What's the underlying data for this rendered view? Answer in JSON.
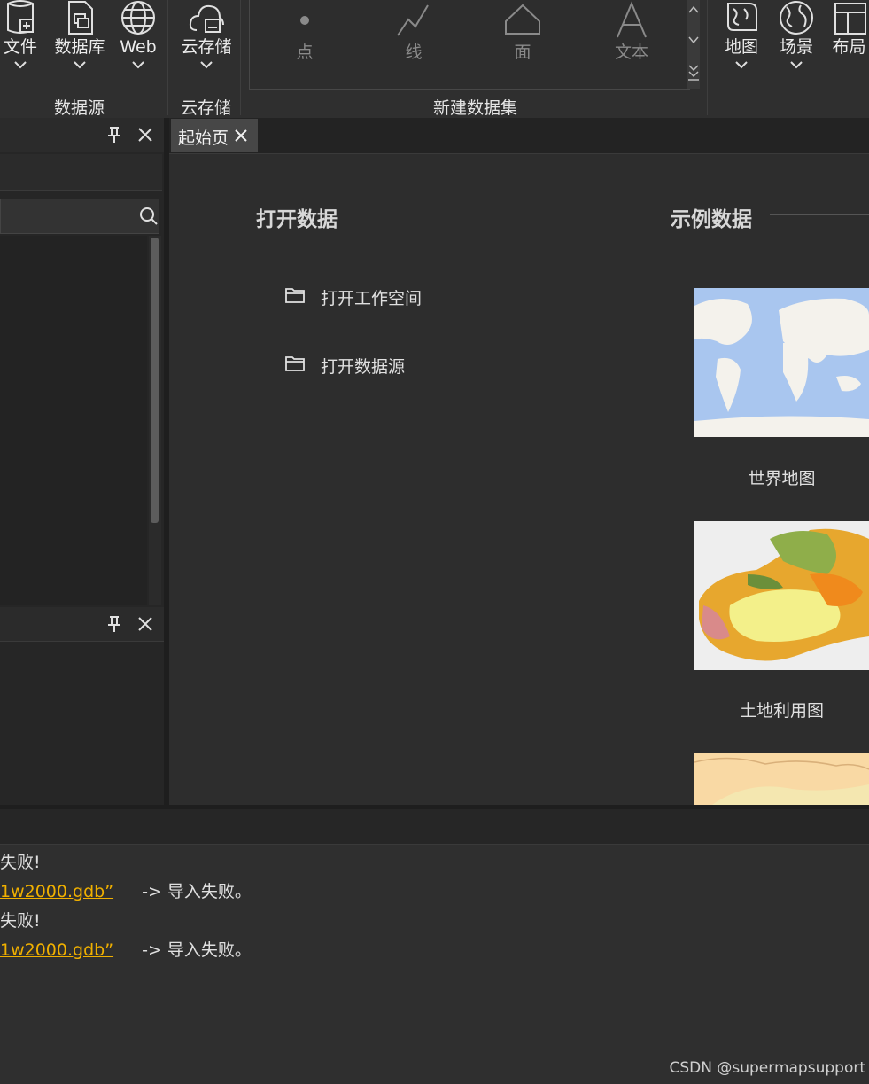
{
  "ribbon": {
    "datasource_group": {
      "label": "数据源",
      "buttons": [
        {
          "label": "文件",
          "icon": "file-datasource-icon"
        },
        {
          "label": "数据库",
          "icon": "database-icon"
        },
        {
          "label": "Web",
          "icon": "globe-icon"
        }
      ]
    },
    "cloud_group": {
      "label": "云存储",
      "buttons": [
        {
          "label": "云存储",
          "icon": "cloud-storage-icon"
        }
      ]
    },
    "dataset_group": {
      "label": "新建数据集",
      "items": [
        {
          "label": "点",
          "icon": "point-icon"
        },
        {
          "label": "线",
          "icon": "line-icon"
        },
        {
          "label": "面",
          "icon": "polygon-icon"
        },
        {
          "label": "文本",
          "icon": "text-icon"
        }
      ]
    },
    "window_buttons": [
      {
        "label": "地图",
        "icon": "map-icon"
      },
      {
        "label": "场景",
        "icon": "scene-globe-icon"
      },
      {
        "label": "布局",
        "icon": "layout-icon"
      }
    ]
  },
  "main": {
    "tab_label": "起始页",
    "open_data": {
      "heading": "打开数据",
      "links": [
        {
          "label": "打开工作空间"
        },
        {
          "label": "打开数据源"
        }
      ]
    },
    "sample_data": {
      "heading": "示例数据",
      "items": [
        {
          "label": "世界地图"
        },
        {
          "label": "土地利用图"
        },
        {
          "label": ""
        }
      ]
    }
  },
  "output": {
    "lines": [
      {
        "text": "失败!",
        "path": "",
        "suffix": ""
      },
      {
        "text": "",
        "path": "1w2000.gdb”",
        "suffix": "-> 导入失败。"
      },
      {
        "text": "失败!",
        "path": "",
        "suffix": ""
      },
      {
        "text": "",
        "path": "1w2000.gdb”",
        "suffix": "-> 导入失败。"
      }
    ]
  },
  "watermark": "CSDN @supermapsupport",
  "colors": {
    "background": "#2b2b2b",
    "accent_link": "#f0b000",
    "text": "#e0e0e0",
    "disabled_text": "#8a8a8a"
  }
}
